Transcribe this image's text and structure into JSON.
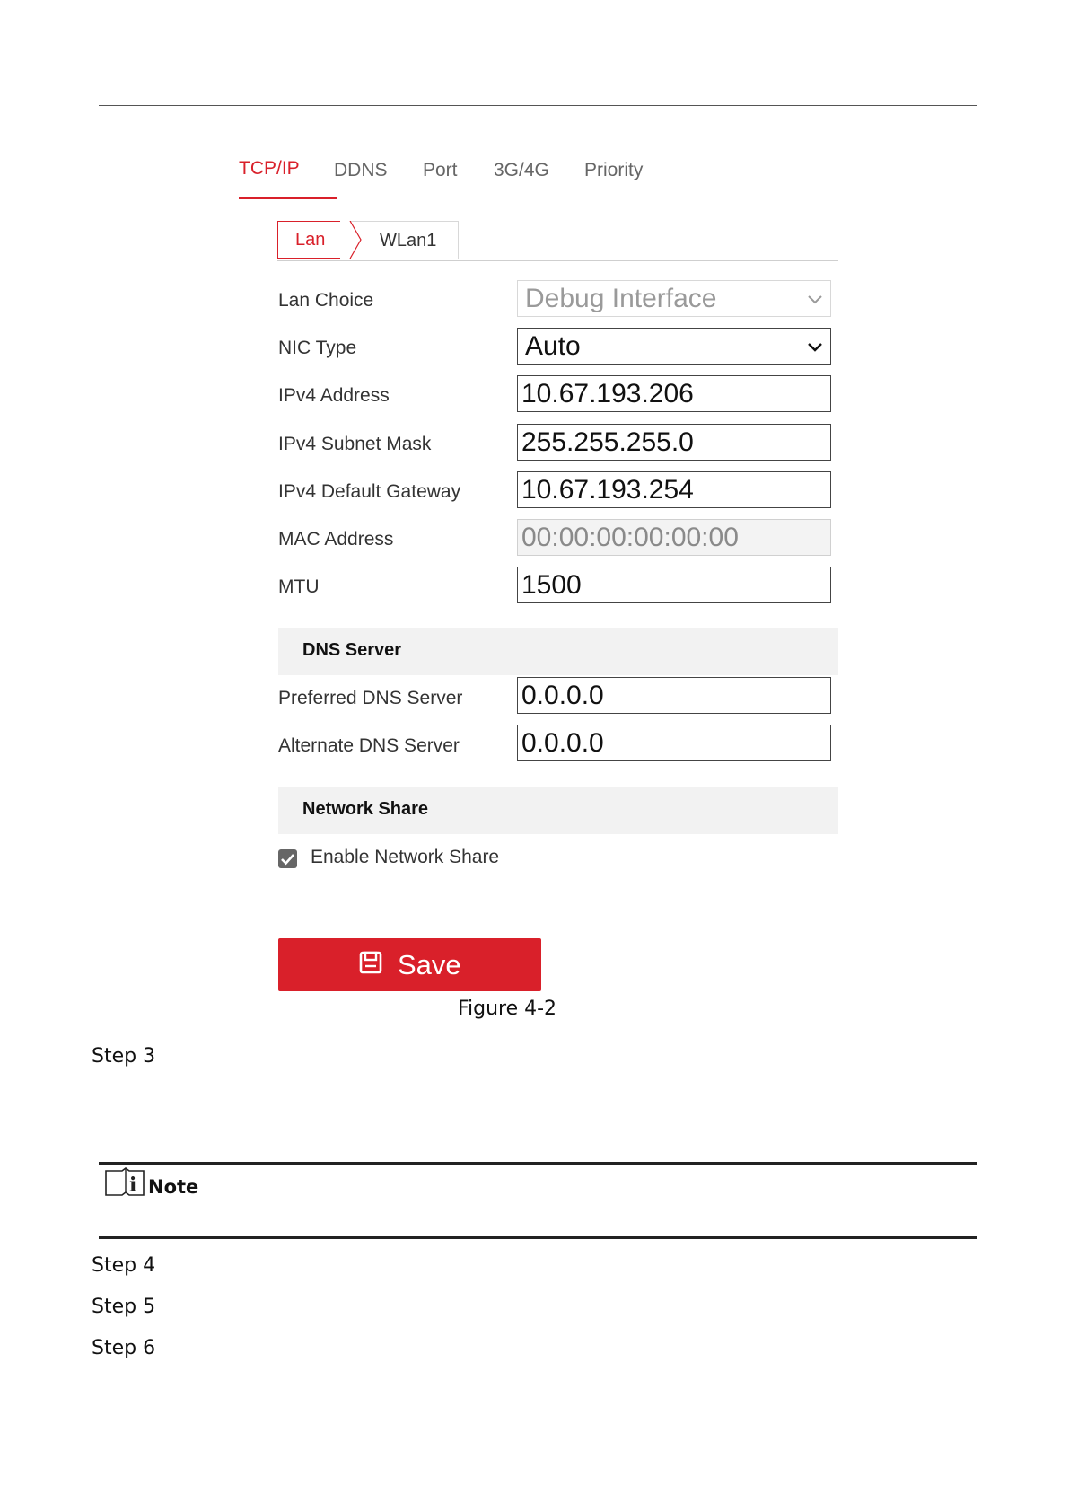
{
  "tabs": [
    "TCP/IP",
    "DDNS",
    "Port",
    "3G/4G",
    "Priority"
  ],
  "subtabs": [
    "Lan",
    "WLan1"
  ],
  "form": {
    "lan_choice": {
      "label": "Lan Choice",
      "value": "Debug Interface"
    },
    "nic_type": {
      "label": "NIC Type",
      "value": "Auto"
    },
    "ipv4_address": {
      "label": "IPv4 Address",
      "value": "10.67.193.206"
    },
    "ipv4_subnet_mask": {
      "label": "IPv4 Subnet Mask",
      "value": "255.255.255.0"
    },
    "ipv4_default_gateway": {
      "label": "IPv4 Default Gateway",
      "value": "10.67.193.254"
    },
    "mac_address": {
      "label": "MAC Address",
      "value": "00:00:00:00:00:00"
    },
    "mtu": {
      "label": "MTU",
      "value": "1500"
    }
  },
  "dns": {
    "title": "DNS Server",
    "preferred": {
      "label": "Preferred DNS Server",
      "value": "0.0.0.0"
    },
    "alternate": {
      "label": "Alternate DNS Server",
      "value": "0.0.0.0"
    }
  },
  "network_share": {
    "title": "Network Share",
    "enable_label": "Enable Network Share",
    "enabled": true
  },
  "save_label": "Save",
  "caption": "Figure 4-2",
  "steps": [
    "Step 3",
    "Step 4",
    "Step 5",
    "Step 6"
  ],
  "note_label": "Note",
  "colors": {
    "accent": "#d9202a",
    "text": "#333333",
    "section_bg": "#f2f2f2"
  }
}
